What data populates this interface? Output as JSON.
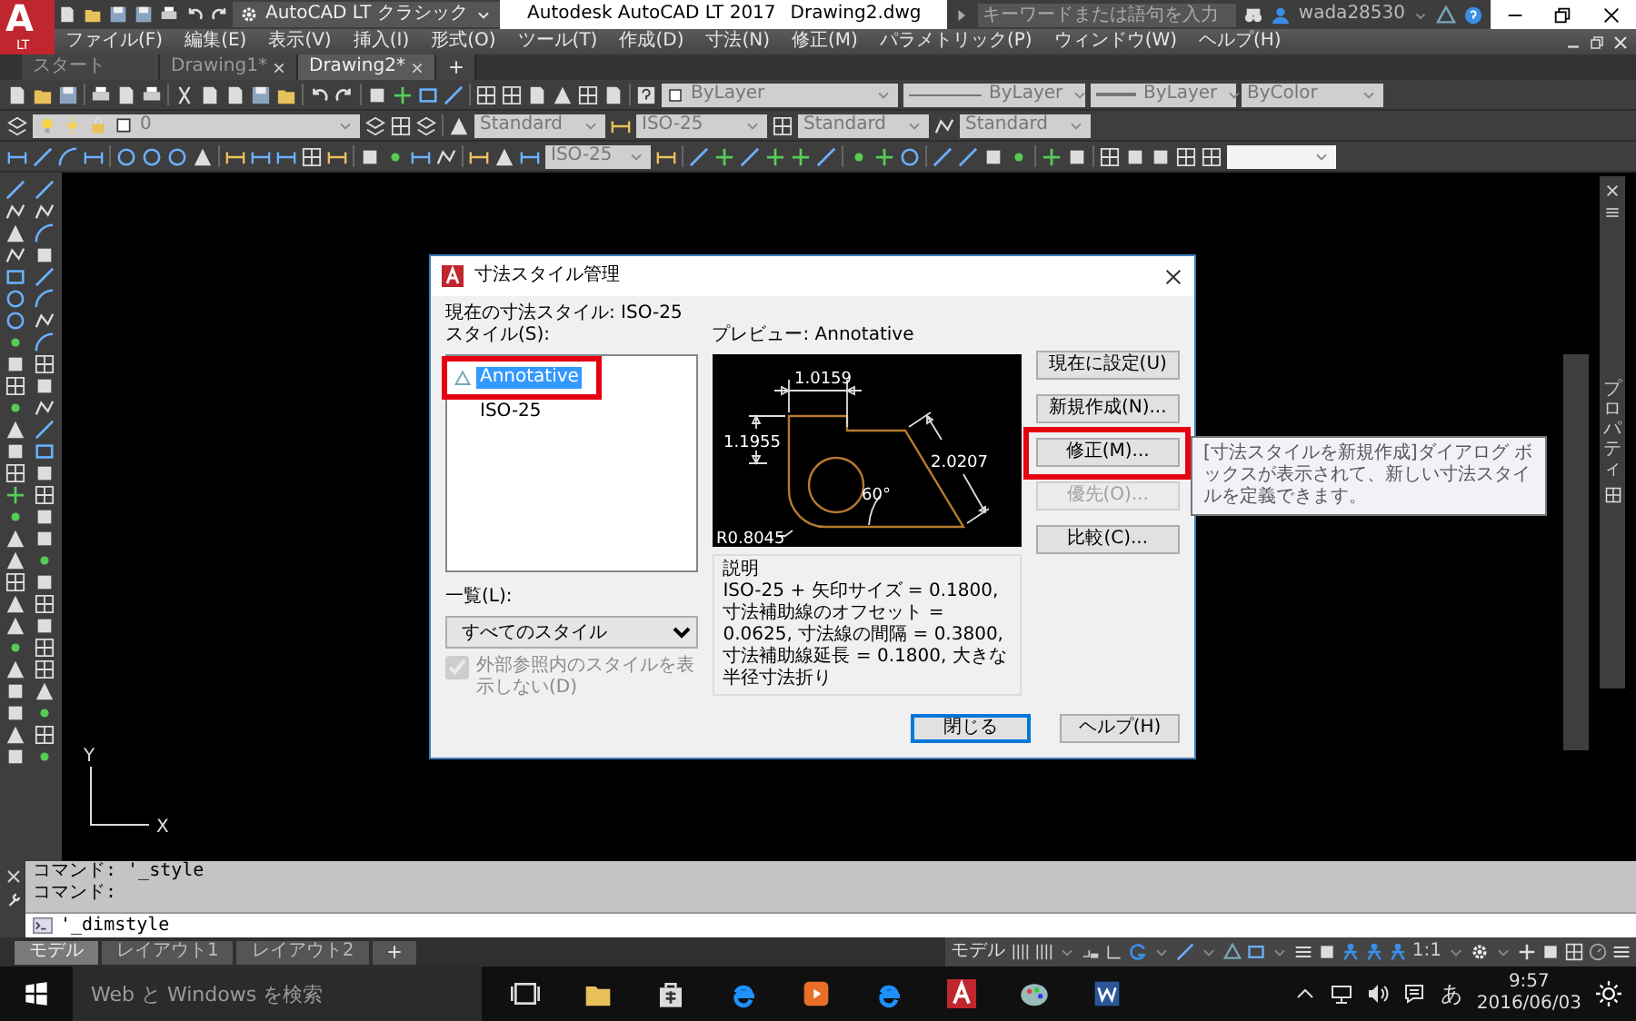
{
  "app": {
    "logo_letter": "A",
    "logo_sub": "LT",
    "workspace": "AutoCAD LT クラシック",
    "title": "Autodesk AutoCAD LT 2017",
    "filename": "Drawing2.dwg",
    "search": {
      "placeholder": "キーワードまたは語句を入力"
    },
    "user": "wada28530"
  },
  "menu": [
    "ファイル(F)",
    "編集(E)",
    "表示(V)",
    "挿入(I)",
    "形式(O)",
    "ツール(T)",
    "作成(D)",
    "寸法(N)",
    "修正(M)",
    "パラメトリック(P)",
    "ウィンドウ(W)",
    "ヘルプ(H)"
  ],
  "tabs": [
    {
      "label": "スタート",
      "selected": false
    },
    {
      "label": "Drawing1*",
      "selected": false
    },
    {
      "label": "Drawing2*",
      "selected": true
    }
  ],
  "properties": {
    "color_control": "ByLayer",
    "linetype": "ByLayer",
    "lineweight": "ByLayer",
    "plot_style": "ByColor"
  },
  "layer": "0",
  "styles": {
    "text": "Standard",
    "dimension": "ISO-25",
    "table": "Standard",
    "multileader": "Standard"
  },
  "dimension_toolbar": {
    "dimstyle": "ISO-25"
  },
  "dialog": {
    "title": "寸法スタイル管理",
    "current_style": "現在の寸法スタイル: ISO-25",
    "styles_label": "スタイル(S):",
    "styles": [
      {
        "label": "Annotative",
        "selected": true,
        "annotative": true,
        "highlighted": true
      },
      {
        "label": "ISO-25",
        "selected": false,
        "annotative": false,
        "highlighted": false
      }
    ],
    "list_label": "一覧(L):",
    "list_value": "すべてのスタイル",
    "xref": {
      "label": "外部参照内のスタイルを表示しない(D)",
      "checked": true,
      "disabled": true
    },
    "preview_label": "プレビュー: Annotative",
    "preview_dims": [
      "1.0159",
      "1.1955",
      "2.0207",
      "60°",
      "R0.8045"
    ],
    "description_label": "説明",
    "description": "ISO-25 + 矢印サイズ = 0.1800, 寸法補助線のオフセット = 0.0625, 寸法線の間隔 = 0.3800, 寸法補助線延長 = 0.1800, 大きな半径寸法折り",
    "side_buttons": [
      {
        "label": "現在に設定(U)",
        "disabled": false,
        "highlighted": false
      },
      {
        "label": "新規作成(N)...",
        "disabled": false,
        "highlighted": false
      },
      {
        "label": "修正(M)...",
        "disabled": false,
        "highlighted": true
      },
      {
        "label": "優先(O)...",
        "disabled": true,
        "highlighted": false
      },
      {
        "label": "比較(C)...",
        "disabled": false,
        "highlighted": false
      }
    ],
    "buttons": [
      {
        "label": "閉じる",
        "default": true
      },
      {
        "label": "ヘルプ(H)",
        "default": false
      }
    ]
  },
  "tooltip": "[寸法スタイルを新規作成]ダイアログ ボックスが表示されて、新しい寸法スタイルを定義できます。",
  "ucs": {
    "y": "Y",
    "x": "X"
  },
  "side_panel": {
    "title": "プロパティ"
  },
  "command": {
    "history": [
      "コマンド: '_style",
      "コマンド:"
    ],
    "input": "'_dimstyle"
  },
  "layout_tabs": [
    {
      "label": "モデル",
      "selected": true
    },
    {
      "label": "レイアウト1",
      "selected": false
    },
    {
      "label": "レイアウト2",
      "selected": false
    }
  ],
  "status_bar": {
    "space": "モデル",
    "scale": "1:1"
  },
  "taskbar": {
    "search": {
      "placeholder": "Web と Windows を検索"
    },
    "ime": "あ",
    "time": "9:57",
    "date": "2016/06/03"
  }
}
